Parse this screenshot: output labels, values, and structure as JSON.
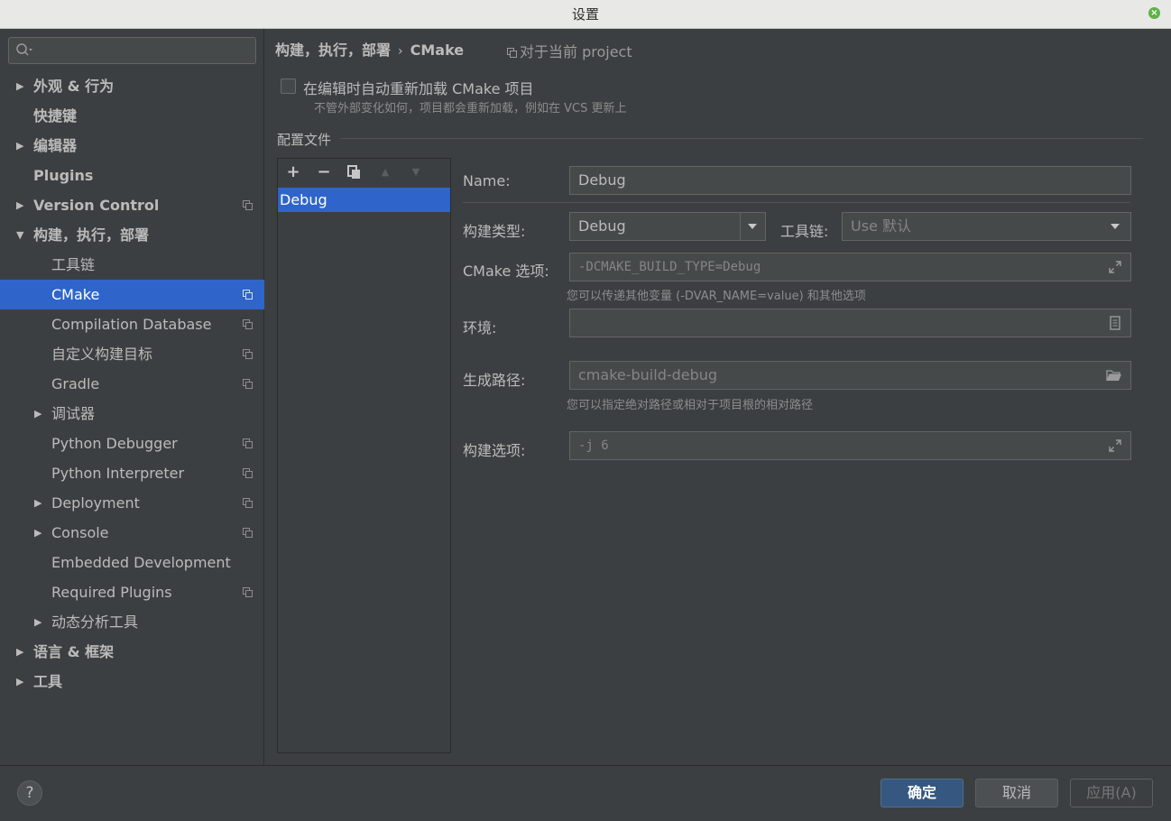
{
  "window": {
    "title": "设置"
  },
  "sidebar": {
    "search_placeholder": "",
    "items": [
      {
        "label": "外观 & 行为",
        "expandable": true,
        "bold": true
      },
      {
        "label": "快捷键",
        "bold": true
      },
      {
        "label": "编辑器",
        "expandable": true,
        "bold": true
      },
      {
        "label": "Plugins",
        "bold": true
      },
      {
        "label": "Version Control",
        "expandable": true,
        "bold": true,
        "project_icon": true
      },
      {
        "label": "构建，执行，部署",
        "expanded": true,
        "bold": true
      },
      {
        "label": "工具链"
      },
      {
        "label": "CMake",
        "selected": true,
        "project_icon": true
      },
      {
        "label": "Compilation Database",
        "project_icon": true
      },
      {
        "label": "自定义构建目标",
        "project_icon": true
      },
      {
        "label": "Gradle",
        "project_icon": true
      },
      {
        "label": "调试器",
        "expandable": true
      },
      {
        "label": "Python Debugger",
        "project_icon": true
      },
      {
        "label": "Python Interpreter",
        "project_icon": true
      },
      {
        "label": "Deployment",
        "expandable": true,
        "project_icon": true
      },
      {
        "label": "Console",
        "expandable": true,
        "project_icon": true
      },
      {
        "label": "Embedded Development"
      },
      {
        "label": "Required Plugins",
        "project_icon": true
      },
      {
        "label": "动态分析工具",
        "expandable": true
      },
      {
        "label": "语言 & 框架",
        "expandable": true,
        "bold": true
      },
      {
        "label": "工具",
        "expandable": true,
        "bold": true
      }
    ]
  },
  "main": {
    "breadcrumb": {
      "parent": "构建，执行，部署",
      "separator": "›",
      "current": "CMake"
    },
    "project_note": "对于当前 project",
    "auto_reload": {
      "label": "在编辑时自动重新加载 CMake 项目",
      "hint": "不管外部变化如何，项目都会重新加载，例如在 VCS 更新上",
      "checked": false
    },
    "profiles_section_title": "配置文件",
    "profiles": [
      "Debug"
    ],
    "form": {
      "name_label": "Name:",
      "name_value": "Debug",
      "build_type_label": "构建类型:",
      "build_type_value": "Debug",
      "toolchain_label": "工具链:",
      "toolchain_value": "Use 默认",
      "cmake_options_label": "CMake 选项:",
      "cmake_options_value": "-DCMAKE_BUILD_TYPE=Debug",
      "cmake_options_hint": "您可以传递其他变量 (-DVAR_NAME=value) 和其他选项",
      "env_label": "环境:",
      "env_value": "",
      "gen_path_label": "生成路径:",
      "gen_path_value": "cmake-build-debug",
      "gen_path_hint": "您可以指定绝对路径或相对于项目根的相对路径",
      "build_options_label": "构建选项:",
      "build_options_value": "-j 6"
    }
  },
  "footer": {
    "help": "?",
    "ok": "确定",
    "cancel": "取消",
    "apply": "应用(A)"
  },
  "colors": {
    "selection": "#2f65ca",
    "background": "#3c3f41",
    "field": "#45494a",
    "ok_button": "#365880"
  }
}
